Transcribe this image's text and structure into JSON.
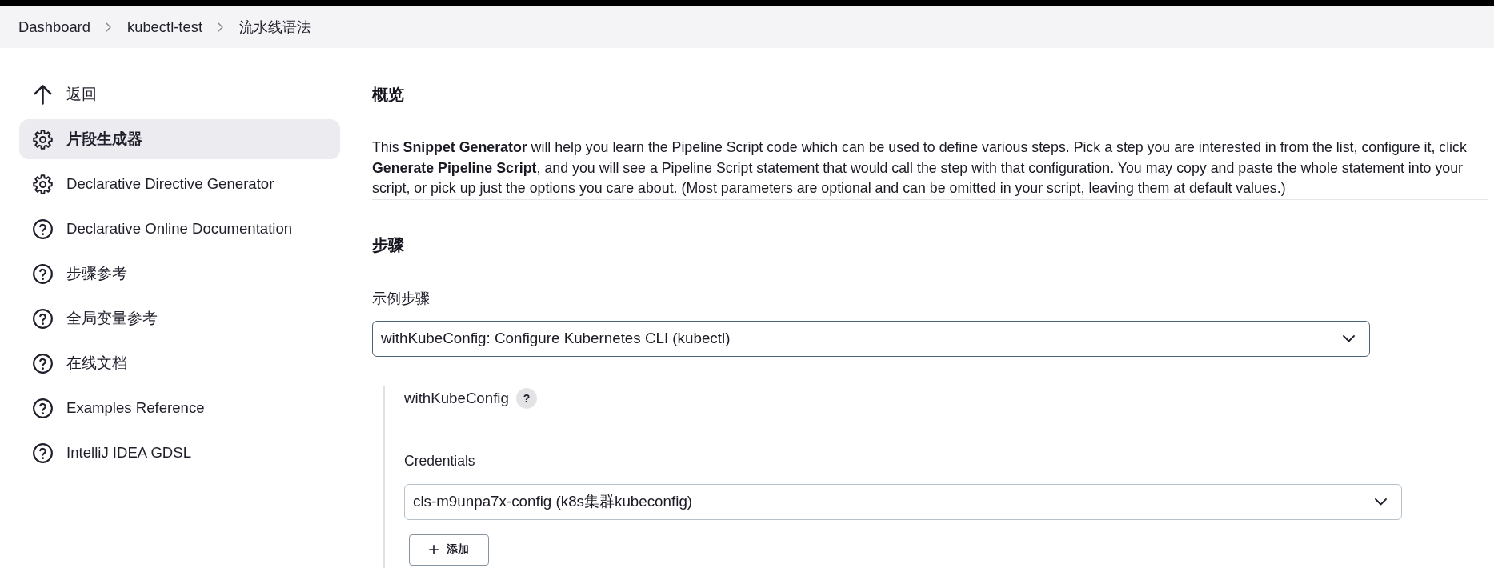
{
  "breadcrumbs": [
    {
      "label": "Dashboard"
    },
    {
      "label": "kubectl-test"
    },
    {
      "label": "流水线语法"
    }
  ],
  "sidebar": {
    "items": [
      {
        "kind": "back",
        "label": "返回",
        "selected": false
      },
      {
        "kind": "generator",
        "label": "片段生成器",
        "selected": true
      },
      {
        "kind": "generator",
        "label": "Declarative Directive Generator",
        "selected": false
      },
      {
        "kind": "help",
        "label": "Declarative Online Documentation",
        "selected": false
      },
      {
        "kind": "help",
        "label": "步骤参考",
        "selected": false
      },
      {
        "kind": "help",
        "label": "全局变量参考",
        "selected": false
      },
      {
        "kind": "help",
        "label": "在线文档",
        "selected": false
      },
      {
        "kind": "help",
        "label": "Examples Reference",
        "selected": false
      },
      {
        "kind": "help",
        "label": "IntelliJ IDEA GDSL",
        "selected": false
      }
    ]
  },
  "overview": {
    "title": "概览",
    "text": "This **Snippet Generator** will help you learn the Pipeline Script code which can be used to define various steps. Pick a step you are interested in from the list, configure it, click **Generate Pipeline Script**, and you will see a Pipeline Script statement that would call the step with that configuration. You may copy and paste the whole statement into your script, or pick up just the options you care about. (Most parameters are optional and can be omitted in your script, leaving them at default values.)"
  },
  "steps": {
    "title": "步骤",
    "sample_step": {
      "label": "示例步骤",
      "value": "withKubeConfig: Configure Kubernetes CLI (kubectl)",
      "focused": true
    },
    "step_config": {
      "name": "withKubeConfig",
      "help": "?",
      "credentials": {
        "label": "Credentials",
        "value": "cls-m9unpa7x-config (k8s集群kubeconfig)",
        "focused": false
      },
      "add_button": {
        "label": "添加"
      }
    }
  }
}
